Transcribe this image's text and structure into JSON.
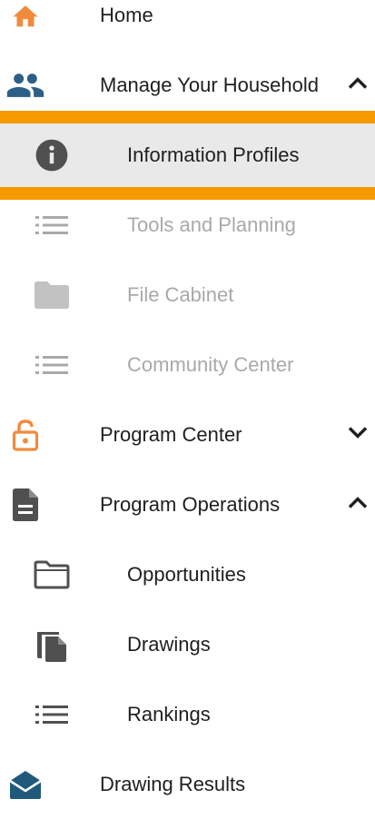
{
  "colors": {
    "accent_orange": "#f18b3c",
    "household_blue": "#2c5f86",
    "dark_icon": "#505050",
    "disabled": "#a9a9a9",
    "selected_bg": "#e9e9e9",
    "highlight": "#f59a00"
  },
  "nav": {
    "home": {
      "label": "Home",
      "icon": "home-icon"
    },
    "household": {
      "label": "Manage Your Household",
      "icon": "people-icon",
      "expanded": true
    },
    "household_children": [
      {
        "label": "Information Profiles",
        "icon": "info-circle-icon",
        "selected": true
      },
      {
        "label": "Tools and Planning",
        "icon": "list-icon",
        "disabled": true
      },
      {
        "label": "File Cabinet",
        "icon": "folder-icon",
        "disabled": true
      },
      {
        "label": "Community Center",
        "icon": "list-icon",
        "disabled": true
      }
    ],
    "program_center": {
      "label": "Program Center",
      "icon": "lock-open-icon",
      "expanded": false
    },
    "program_operations": {
      "label": "Program Operations",
      "icon": "document-icon",
      "expanded": true
    },
    "operations_children": [
      {
        "label": "Opportunities",
        "icon": "folder-outline-icon"
      },
      {
        "label": "Drawings",
        "icon": "copy-icon"
      },
      {
        "label": "Rankings",
        "icon": "list-icon"
      }
    ],
    "drawing_results": {
      "label": "Drawing Results",
      "icon": "envelope-open-icon"
    }
  }
}
